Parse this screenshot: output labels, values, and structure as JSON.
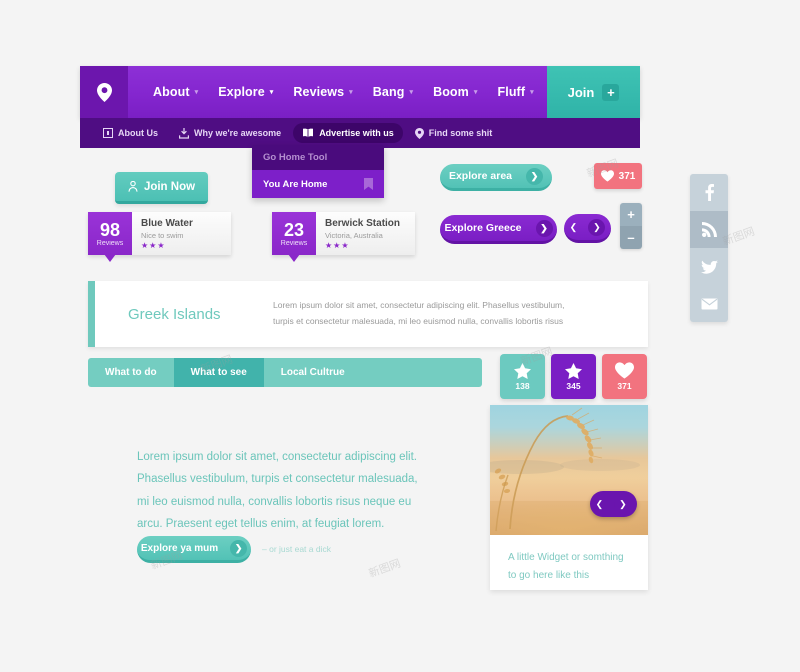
{
  "nav": {
    "logo_icon": "location-pin-icon",
    "items": [
      {
        "label": "About",
        "caret": "▾"
      },
      {
        "label": "Explore",
        "caret": "▾"
      },
      {
        "label": "Reviews",
        "caret": "▾"
      },
      {
        "label": "Bang",
        "caret": "▾"
      },
      {
        "label": "Boom",
        "caret": "▾"
      },
      {
        "label": "Fluff",
        "caret": "▾"
      }
    ],
    "join_label": "Join",
    "join_plus": "+",
    "subnav": [
      {
        "label": "About Us",
        "icon": "square-box-icon"
      },
      {
        "label": "Why we're awesome",
        "icon": "download-icon"
      },
      {
        "label": "Advertise with us",
        "icon": "book-icon"
      },
      {
        "label": "Find some shit",
        "icon": "location-pin-icon"
      }
    ]
  },
  "dropdown": {
    "header": "Go Home Tool",
    "selected": "You Are Home",
    "selected_icon": "bookmark-icon"
  },
  "join_now": {
    "label": "Join Now",
    "icon": "user-lock-icon"
  },
  "review_cards": [
    {
      "count": "98",
      "count_label": "Reviews",
      "title": "Blue Water",
      "subtitle": "Nice to swim",
      "stars": "★★★"
    },
    {
      "count": "23",
      "count_label": "Reviews",
      "title": "Berwick Station",
      "subtitle": "Victoria, Australia",
      "stars": "★★★"
    }
  ],
  "buttons": {
    "explore_area": "Explore area",
    "explore_greece": "Explore Greece",
    "arrow_right": "❯",
    "arrow_left": "❮",
    "zoom_in": "+",
    "zoom_out": "–"
  },
  "heart_badge": {
    "count": "371",
    "icon": "heart-icon"
  },
  "panel": {
    "title": "Greek Islands",
    "line1": "Lorem ipsum dolor sit amet, consectetur adipiscing elit. Phasellus vestibulum,",
    "line2": "turpis et consectetur malesuada, mi leo euismod nulla, convallis lobortis risus"
  },
  "tabs": [
    {
      "label": "What to do",
      "active": false
    },
    {
      "label": "What to see",
      "active": true
    },
    {
      "label": "Local Cultrue",
      "active": false
    }
  ],
  "stat_badges": [
    {
      "icon": "star-icon",
      "count": "138",
      "color": "#6ccac0"
    },
    {
      "icon": "star-icon",
      "count": "345",
      "color": "#7a1ec4"
    },
    {
      "icon": "heart-icon",
      "count": "371",
      "color": "#f2737f"
    }
  ],
  "content": {
    "line1": "Lorem ipsum dolor sit amet, consectetur adipiscing elit.",
    "line2": "Phasellus vestibulum, turpis et consectetur malesuada,",
    "line3": "mi leo euismod nulla, convallis lobortis risus neque eu",
    "line4": "arcu. Praesent eget tellus enim, at feugiat lorem.",
    "cta_label": "Explore ya mum",
    "cta_note": "– or just eat a dick"
  },
  "widget": {
    "image_alt": "wheat-field-photo",
    "caption_line1": "A little Widget or somthing",
    "caption_line2": "to go here like this"
  },
  "social": [
    {
      "icon": "facebook-icon",
      "active": false
    },
    {
      "icon": "rss-icon",
      "active": true
    },
    {
      "icon": "twitter-icon",
      "active": false
    },
    {
      "icon": "email-icon",
      "active": false
    }
  ],
  "watermarks": [
    "新图网",
    "新图网",
    "新图网",
    "新图网",
    "新图网",
    "新图网"
  ]
}
